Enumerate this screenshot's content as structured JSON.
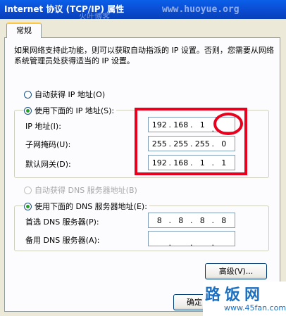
{
  "window": {
    "title": "Internet 协议 (TCP/IP) 属性"
  },
  "watermarks": {
    "site": "www.huoyue.org",
    "small": "火叶博客",
    "brand": "路饭网",
    "brand_url": "www.45fan.com"
  },
  "tab": {
    "label": "常规"
  },
  "description": "如果网络支持此功能，则可以获取自动指派的 IP 设置。否则，您需要从网络系统管理员处获得适当的 IP 设置。",
  "ip_mode": {
    "auto_label": "自动获得 IP 地址(O)",
    "manual_label": "使用下面的 IP 地址(S):",
    "selected": "manual"
  },
  "ip_fields": {
    "ip": {
      "label": "IP 地址(I):",
      "octets": [
        "192",
        "168",
        "1",
        ""
      ]
    },
    "subnet": {
      "label": "子网掩码(U):",
      "octets": [
        "255",
        "255",
        "255",
        "0"
      ]
    },
    "gateway": {
      "label": "默认网关(D):",
      "octets": [
        "192",
        "168",
        "1",
        "1"
      ]
    }
  },
  "dns_mode": {
    "auto_label": "自动获得 DNS 服务器地址(B)",
    "manual_label": "使用下面的 DNS 服务器地址(E):",
    "selected": "manual"
  },
  "dns_fields": {
    "preferred": {
      "label": "首选 DNS 服务器(P):",
      "octets": [
        "8",
        "8",
        "8",
        "8"
      ]
    },
    "alternate": {
      "label": "备用 DNS 服务器(A):",
      "octets": [
        "",
        "",
        "",
        ""
      ]
    }
  },
  "buttons": {
    "advanced": "高级(V)...",
    "ok": "确定"
  },
  "colors": {
    "annotation": "#e8001c",
    "title_bar": "#0a5fe8"
  }
}
